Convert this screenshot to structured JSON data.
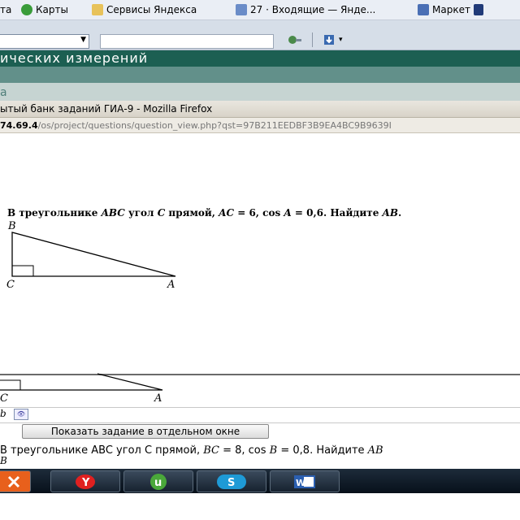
{
  "bookmarks": [
    {
      "label": "та",
      "icon": "bookmark-icon",
      "color": "#8aa0c8"
    },
    {
      "label": "Карты",
      "icon": "maps-icon",
      "color": "#3a9c3a"
    },
    {
      "label": "Сервисы Яндекса",
      "icon": "folder-icon",
      "color": "#e8c25a"
    },
    {
      "label": "27 · Входящие — Янде...",
      "icon": "mail-icon",
      "color": "#6a8cc8"
    },
    {
      "label": "Маркет",
      "icon": "market-icon",
      "color": "#4a6fb5"
    }
  ],
  "site": {
    "title": "ических измерений",
    "tab": "а"
  },
  "firefox": {
    "title": "ытый банк заданий ГИА-9 - Mozilla Firefox",
    "url_host": "74.69.4",
    "url_path": "/os/project/questions/question_view.php?qst=97B211EEDBF3B9EA4BC9B9639I"
  },
  "problem": {
    "text_1": "В треугольнике ",
    "abc": "ABC",
    "text_2": " угол ",
    "c": "C",
    "text_3": " прямой, ",
    "ac": "AC",
    "text_4": " = 6, cos ",
    "a": "A",
    "text_5": " = 0,6. Найдите ",
    "ab": "AB",
    "text_6": "."
  },
  "triangle": {
    "vertex_b": "B",
    "vertex_c": "C",
    "vertex_a": "A"
  },
  "lower": {
    "vertex_c": "C",
    "vertex_a": "A",
    "answer_label": "b",
    "answer_btn": "👁",
    "show_button": "Показать задание в отдельном окне",
    "p2_1": "В треугольнике ABC угол C прямой, ",
    "p2_bc": "BC",
    "p2_2": " = 8, cos ",
    "p2_b": "B",
    "p2_3": " = 0,8. Найдите ",
    "p2_ab": "AB",
    "frag_b": "B"
  },
  "taskbar": [
    {
      "name": "yandex-browser-task",
      "icon": "yandex-icon",
      "color": "#e8601c"
    },
    {
      "name": "yandex-task",
      "icon": "yandex-y-icon",
      "color": "#e02020"
    },
    {
      "name": "utorrent-task",
      "icon": "utorrent-icon",
      "color": "#4aa83a"
    },
    {
      "name": "skype-task",
      "icon": "skype-icon",
      "color": "#1e9ad6"
    },
    {
      "name": "word-task",
      "icon": "word-icon",
      "color": "#2b5fb0"
    }
  ],
  "colors": {
    "site_header": "#1c5f52",
    "taskbar": "#0c1622"
  }
}
